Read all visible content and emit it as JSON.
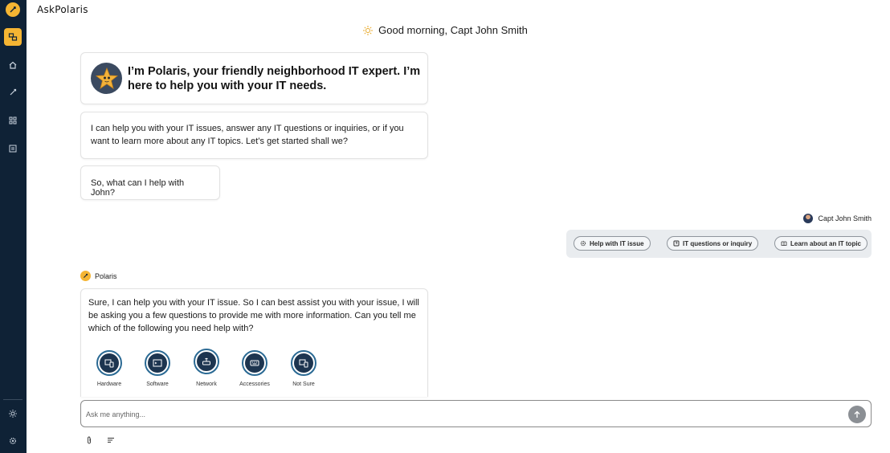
{
  "app": {
    "title": "AskPolaris"
  },
  "greeting": "Good morning, Capt John Smith",
  "messages": {
    "intro": "I’m Polaris, your friendly neighborhood IT expert. I’m here to help you with your IT needs.",
    "capabilities": "I can help you with your IT issues, answer any IT questions or inquiries, or if you want to learn more about any IT topics. Let’s get started shall we?",
    "prompt": "So, what can I help with John?",
    "followup": "Sure, I can help you with your IT issue. So I can best assist you with your issue, I will be asking you a few questions to provide me with more information. Can you tell me which of the following you need help with?"
  },
  "user": {
    "name": "Capt John Smith"
  },
  "bot": {
    "name": "Polaris"
  },
  "chips": [
    {
      "label": "Help with IT issue",
      "icon": "gear-icon"
    },
    {
      "label": "IT questions or inquiry",
      "icon": "question-icon"
    },
    {
      "label": "Learn about an IT topic",
      "icon": "book-icon"
    }
  ],
  "categories": [
    {
      "label": "Hardware",
      "icon": "devices-icon"
    },
    {
      "label": "Software",
      "icon": "terminal-icon"
    },
    {
      "label": "Network",
      "icon": "router-icon"
    },
    {
      "label": "Accessories",
      "icon": "keyboard-icon"
    },
    {
      "label": "Not Sure",
      "icon": "devices-icon"
    }
  ],
  "input": {
    "placeholder": "Ask me anything..."
  },
  "colors": {
    "sidebar": "#0f2236",
    "accent": "#f5b533",
    "ring": "#2b6a94"
  }
}
